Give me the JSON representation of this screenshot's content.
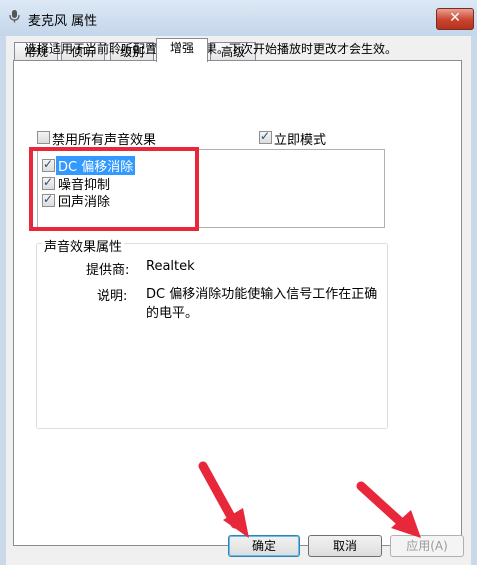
{
  "window": {
    "title": "麦克风 属性",
    "close_label": "✕"
  },
  "tabs": [
    {
      "label": "常规"
    },
    {
      "label": "侦听"
    },
    {
      "label": "级别"
    },
    {
      "label": "增强"
    },
    {
      "label": "高级"
    }
  ],
  "enhancements": {
    "description": "选择适用于当前聆听配置的声音效果。下次开始播放时更改才会生效。",
    "disable_all": {
      "label": "禁用所有声音效果",
      "checked": false
    },
    "immediate_mode": {
      "label": "立即模式",
      "checked": true
    },
    "effects": [
      {
        "label": "DC 偏移消除",
        "checked": true,
        "selected": true
      },
      {
        "label": "噪音抑制",
        "checked": true,
        "selected": false
      },
      {
        "label": "回声消除",
        "checked": true,
        "selected": false
      }
    ]
  },
  "properties": {
    "title": "声音效果属性",
    "provider_label": "提供商:",
    "provider_value": "Realtek",
    "description_label": "说明:",
    "description_value": "DC 偏移消除功能使输入信号工作在正确的电平。"
  },
  "buttons": {
    "ok": "确定",
    "cancel": "取消",
    "apply": "应用(A)"
  },
  "colors": {
    "annotation_red": "#e8283a",
    "selection_blue": "#3399ff"
  }
}
